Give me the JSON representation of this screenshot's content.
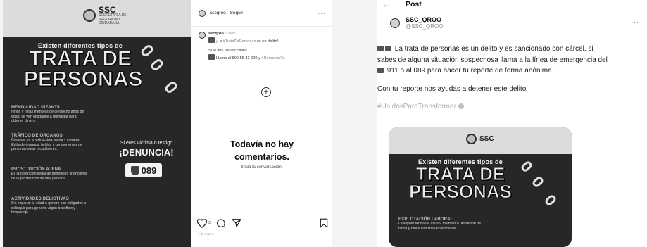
{
  "instagram": {
    "poster": {
      "brand": "SSC",
      "brand_sub": "SECRETARÍA DE SEGURIDAD CIUDADANA",
      "headline_small": "Existen diferentes tipos de",
      "headline_line1": "TRATA DE",
      "headline_line2": "PERSONAS",
      "sections": [
        {
          "title": "MENDICIDAD INFANTIL",
          "text": "Niños y niñas menores de dieciocho años de edad, se ven obligados a mendigar para obtener dinero."
        },
        {
          "title": "TRÁFICO DE ÓRGANOS",
          "text": "Consiste en la extracción, venta y compra ilícita de órganos, tejidos y componentes de personas vivas o cadáveres."
        },
        {
          "title": "PROSTITUCIÓN AJENA",
          "text": "Es la obtención ilegal de beneficios financieros de la prostitución de otra persona."
        },
        {
          "title": "ACTIVIDADES DELICTIVAS",
          "text": "Sin importar la edad o género son obligados a delinquir para generar algún beneficio y hospedaje."
        }
      ],
      "denuncia_question": "Si eres víctima o testigo",
      "denuncia_call": "¡DENUNCIA!",
      "emergency_number": "089"
    },
    "header": {
      "username": "sscqroo",
      "follow": "Seguir",
      "more": "···"
    },
    "caption": {
      "username": "sscqroo",
      "time": "2 sem",
      "line1_prefix": "¡La ",
      "line1_tag": "#TrataDePersonas",
      "line1_suffix": " es un delito!",
      "line2": "Si la ves, NO te calles.",
      "line3_prefix": "Llama al 800 55 33 000 y ",
      "line3_tag": "#DenunciaYa"
    },
    "no_comments_line1": "Todavía no hay",
    "no_comments_line2": "comentarios.",
    "start_conversation": "Inicia la conversación.",
    "likes": "3",
    "date": "7 de marzo"
  },
  "x": {
    "back": "←",
    "title": "Post",
    "display_name": "SSC_QROO",
    "handle": "@SSC_QROO",
    "more": "···",
    "body_line1": "La trata de personas es un delito y es sancionado con cárcel, si",
    "body_line2": "sabes de alguna situación sospechosa llama a la línea de emergencia del",
    "body_line3": "911 o al 089 para hacer tu reporte de forma anónima.",
    "body_para2": "Con tu reporte nos ayudas a detener este delito.",
    "hashtag": "#UnidosParaTransformar",
    "media": {
      "brand": "SSC",
      "headline_small": "Existen diferentes tipos de",
      "headline_line1": "TRATA DE",
      "headline_line2": "PERSONAS",
      "section_title": "EXPLOTACIÓN LABORAL",
      "section_text": "Cualquier forma de abuso, maltrato o utilización de niños y niñas con fines económicos."
    }
  }
}
